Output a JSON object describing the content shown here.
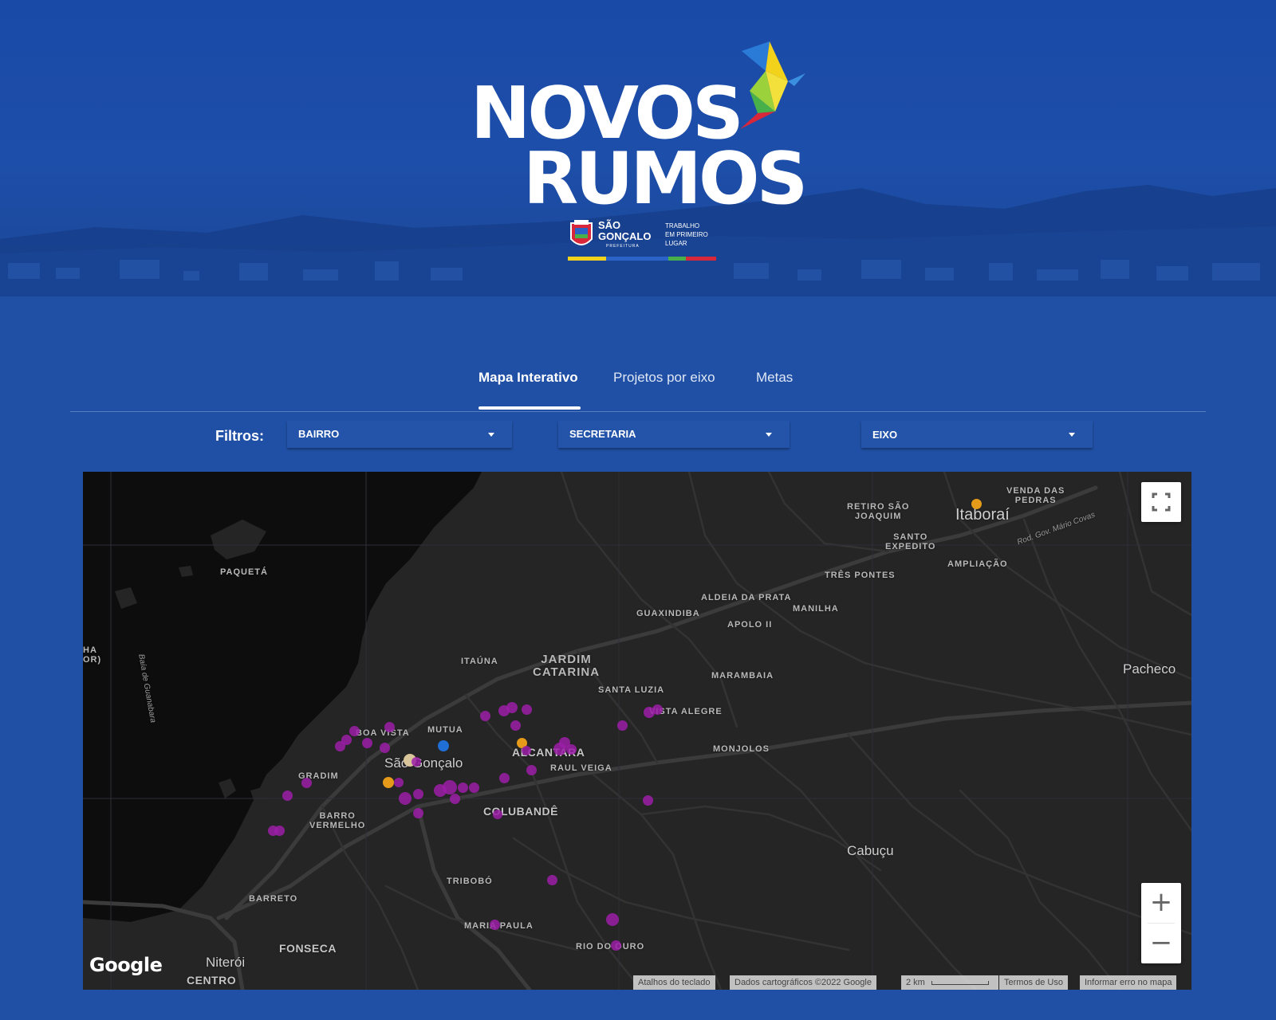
{
  "hero": {
    "logo_line1": "NOVOS",
    "logo_line2": "RUMOS",
    "gov_name": "SÃO\nGONÇALO",
    "gov_sub": "PREFEITURA",
    "gov_tagline": "TRABALHO\nEM PRIMEIRO\nLUGAR",
    "stripe_colors": [
      "#f2d21b",
      "#2a62c8",
      "#47b04a",
      "#d8263a"
    ]
  },
  "tabs": [
    {
      "label": "Mapa Interativo",
      "active": true
    },
    {
      "label": "Projetos por eixo",
      "active": false
    },
    {
      "label": "Metas",
      "active": false
    }
  ],
  "filters": {
    "label": "Filtros:",
    "selects": [
      {
        "value": "BAIRRO"
      },
      {
        "value": "SECRETARIA"
      },
      {
        "value": "EIXO"
      }
    ]
  },
  "map": {
    "places": {
      "paqueta": "PAQUETÁ",
      "baia": "Baía de Guanabara",
      "ha_or": "HA\nOR)",
      "retiro": "RETIRO SÃO\nJOAQUIM",
      "venda": "VENDA DAS\nPEDRAS",
      "itaborai": "Itaboraí",
      "santo_expedito": "SANTO\nEXPEDITO",
      "ampliacao": "AMPLIAÇÃO",
      "rod_gov": "Rod. Gov. Mário Covas",
      "tres_pontes": "TRÊS PONTES",
      "aldeia": "ALDEIA DA PRATA",
      "manilha": "MANILHA",
      "guaxindiba": "GUAXINDIBA",
      "apolo": "APOLO II",
      "itauna": "ITAÚNA",
      "jardim_catarina": "JARDIM\nCATARINA",
      "marambaia": "MARAMBAIA",
      "pacheco": "Pacheco",
      "santa_luzia": "SANTA LUZIA",
      "vista_alegre": "VISTA ALEGRE",
      "boa_vista": "BOA VISTA",
      "mutua": "MUTUA",
      "sao_goncalo": "São Gonçalo",
      "alcantara": "ALCANTARA",
      "raul_veiga": "RAUL VEIGA",
      "monjolos": "MONJOLOS",
      "gradim": "GRADIM",
      "barro_vermelho": "BARRO\nVERMELHO",
      "colubande": "COLUBANDÊ",
      "cabucu": "Cabuçu",
      "tribobo": "TRIBOBÓ",
      "barreto": "BARRETO",
      "maria_paula": "MARIA PAULA",
      "fonseca": "FONSECA",
      "niteroi": "Niterói",
      "centro": "CENTRO",
      "rio_do_ouro": "RIO DO OURO"
    },
    "marker_colors": {
      "purple": "#9c1fa8",
      "orange": "#e59a1a",
      "blue": "#1f6fd6",
      "pale": "#d8c59a"
    },
    "google_logo": "Google",
    "attribution": {
      "shortcuts": "Atalhos do teclado",
      "data": "Dados cartográficos ©2022 Google",
      "scale": "2 km",
      "terms": "Termos de Uso",
      "report": "Informar erro no mapa"
    },
    "zoom_in": "+",
    "zoom_out": "−"
  }
}
